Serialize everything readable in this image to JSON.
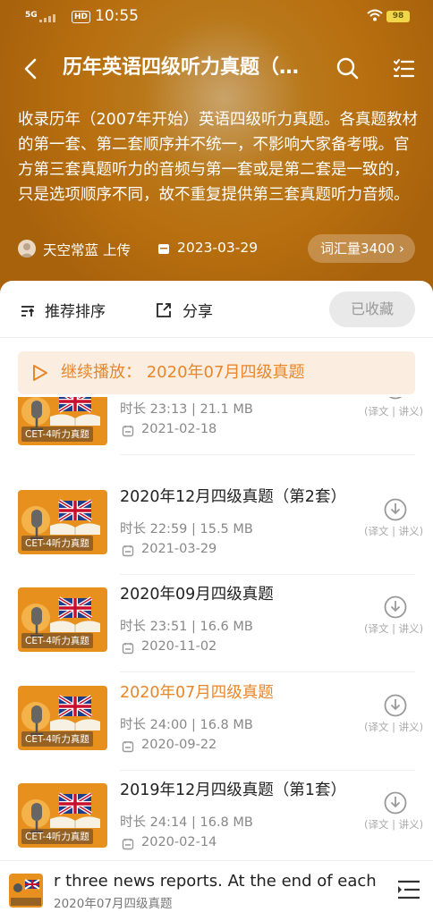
{
  "status_bar": {
    "network": "5G",
    "hd": "HD",
    "time": "10:55",
    "battery": "98"
  },
  "header": {
    "title": "历年英语四级听力真题（…",
    "description": "收录历年（2007年开始）英语四级听力真题。各真题教材的第一套、第二套顺序并不统一，不影响大家备考哦。官方第三套真题听力的音频与第一套或是第二套是一致的，只是选项顺序不同，故不重复提供第三套真题听力音频。",
    "uploader": "天空常蓝",
    "upload_label": "上传",
    "date": "2023-03-29",
    "vocab": "词汇量3400",
    "vocab_arrow": "›"
  },
  "actions": {
    "sort": "推荐排序",
    "share": "分享",
    "favorite": "已收藏"
  },
  "continue": {
    "prefix": "继续播放：",
    "title": "2020年07月四级真题"
  },
  "thumb_tag": "CET-4听力真题",
  "items": [
    {
      "title": "",
      "duration": "时长 23:13 | 21.1 MB",
      "date": "2021-02-18",
      "sub": "(译文 | 讲义)",
      "active": false
    },
    {
      "title": "2020年12月四级真题（第2套）",
      "duration": "时长 22:59 | 15.5 MB",
      "date": "2021-03-29",
      "sub": "(译文 | 讲义)",
      "active": false
    },
    {
      "title": "2020年09月四级真题",
      "duration": "时长 23:51 | 16.6 MB",
      "date": "2020-11-02",
      "sub": "(译文 | 讲义)",
      "active": false
    },
    {
      "title": "2020年07月四级真题",
      "duration": "时长 24:00 | 16.8 MB",
      "date": "2020-09-22",
      "sub": "(译文 | 讲义)",
      "active": true
    },
    {
      "title": "2019年12月四级真题（第1套）",
      "duration": "时长 24:14 | 16.8 MB",
      "date": "2020-02-14",
      "sub": "(译文 | 讲义)",
      "active": false
    }
  ],
  "player": {
    "line1": "r three news reports. At the end of each",
    "line2": "2020年07月四级真题",
    "mini_tag": "CET-4听力真题"
  },
  "colors": {
    "accent": "#e8862a",
    "header_bg": "#b86f0f",
    "continue_bg": "#fbeee1"
  }
}
